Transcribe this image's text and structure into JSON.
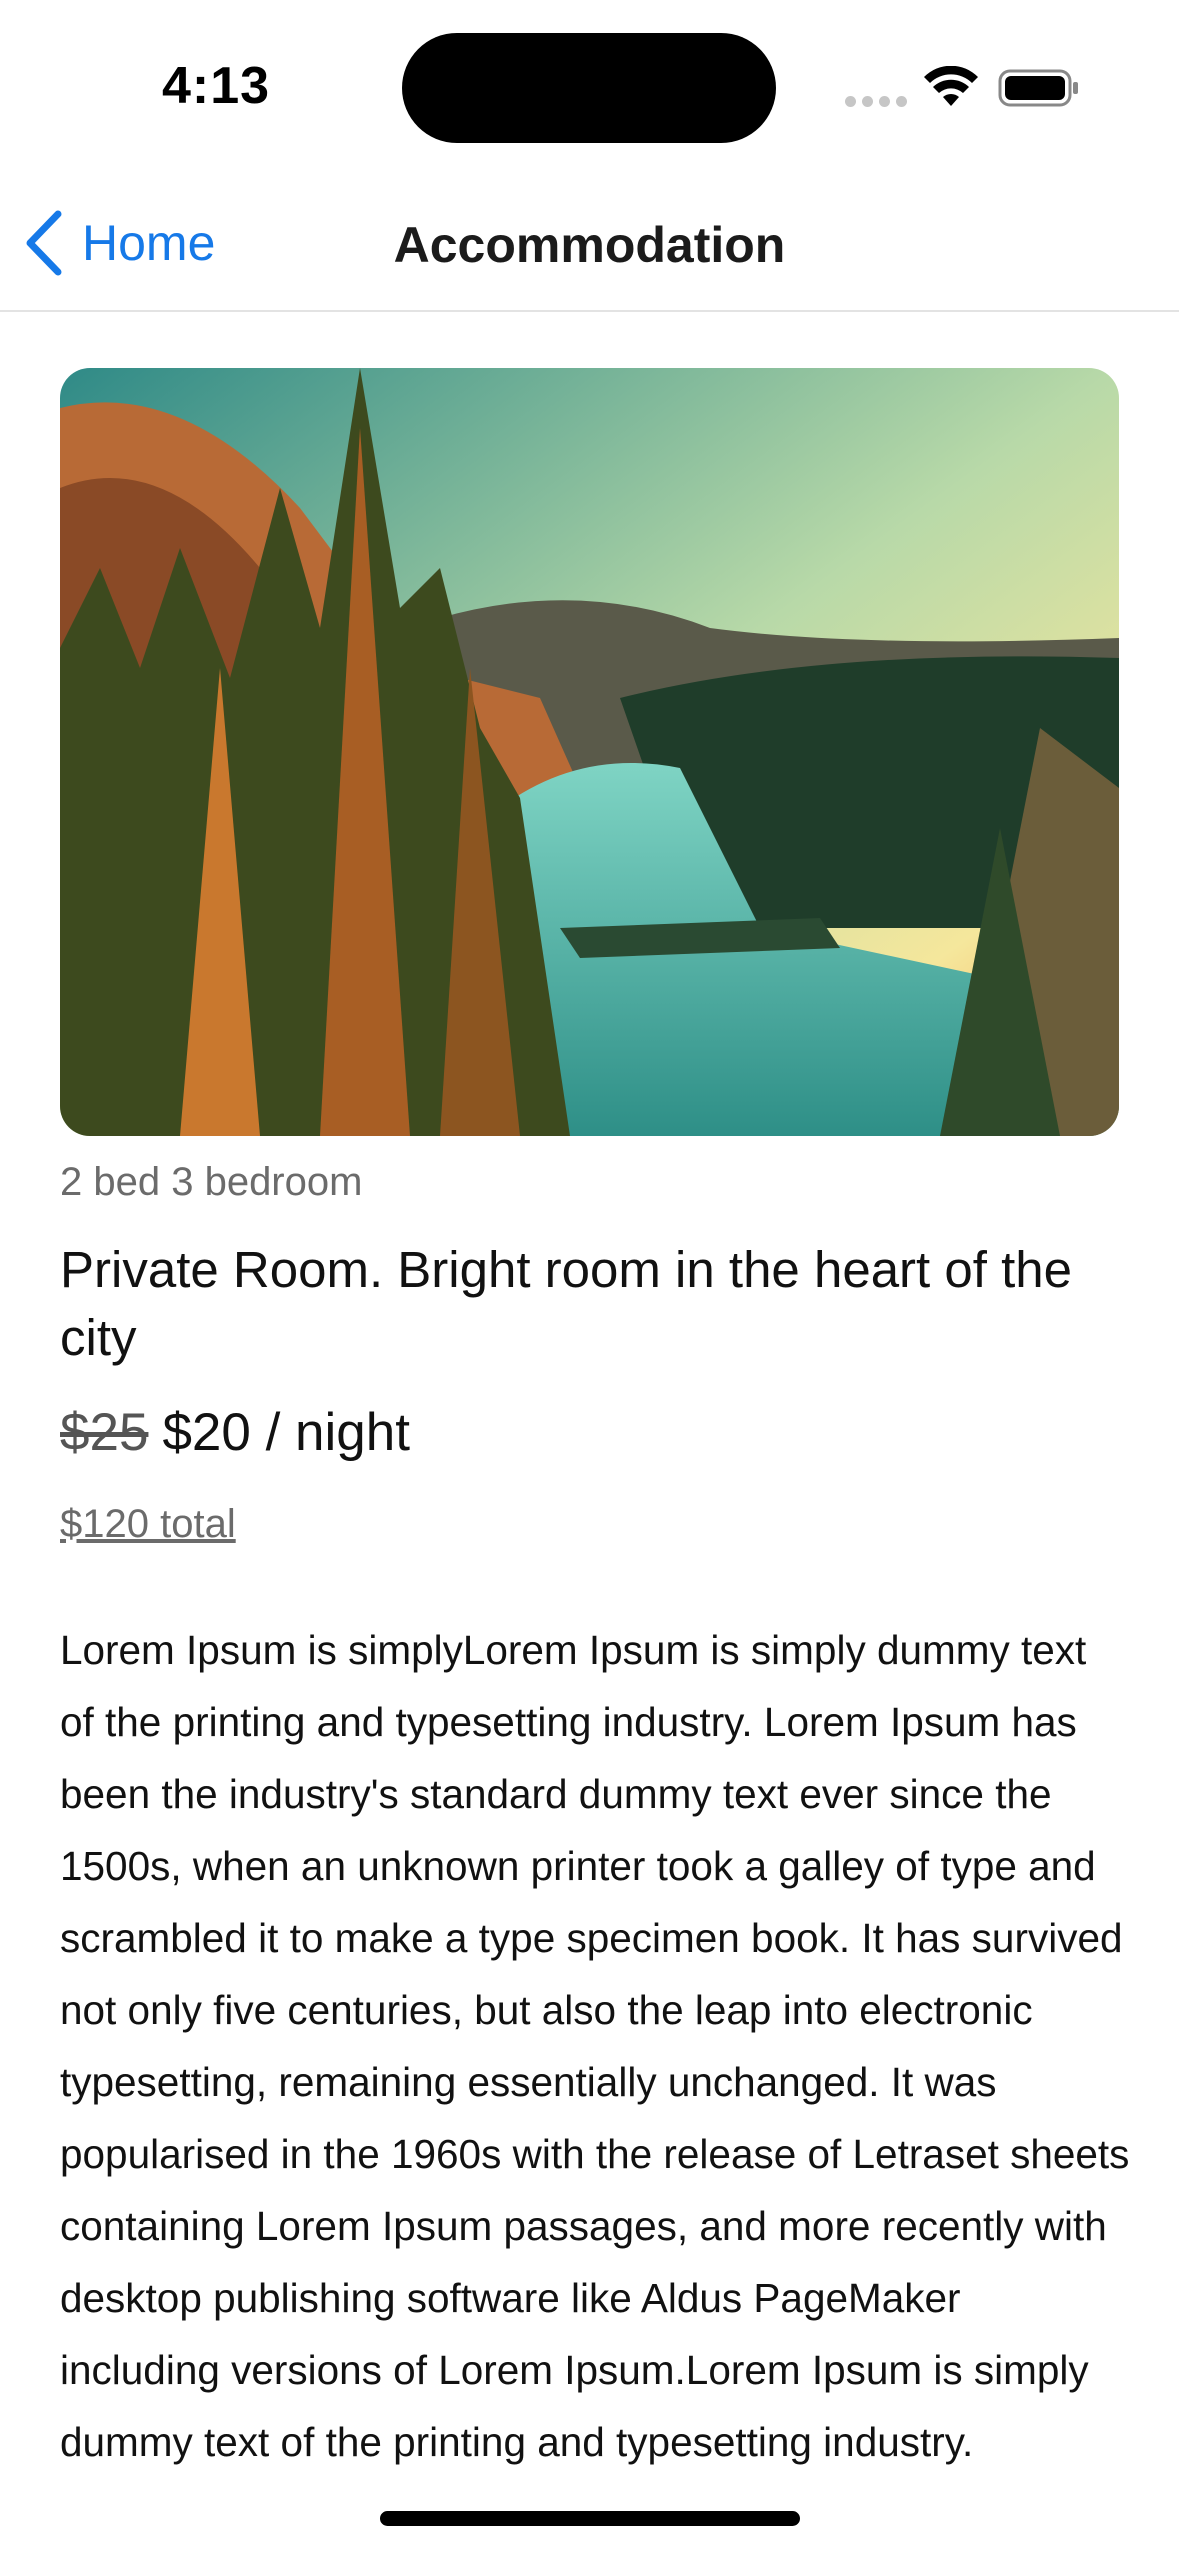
{
  "status_bar": {
    "time": "4:13",
    "icons": [
      "cellular-signal-icon",
      "wifi-icon",
      "battery-icon"
    ]
  },
  "nav": {
    "back_label": "Home",
    "title": "Accommodation",
    "back_icon": "chevron-left-icon",
    "accent_color": "#1679e8"
  },
  "listing": {
    "image_alt": "Mountain lake with pine trees at sunset",
    "beds": "2 bed 3 bedroom",
    "title": "Private Room. Bright room in the heart of the city",
    "old_price": "$25",
    "price": "$20 / night",
    "total": "$120 total",
    "description": "Lorem Ipsum is simplyLorem Ipsum is simply dummy text of the printing and typesetting industry. Lorem Ipsum has been the industry's standard dummy text ever since the 1500s, when an unknown printer took a galley of type and scrambled it to make a type specimen book. It has survived not only five centuries, but also the leap into electronic typesetting, remaining essentially unchanged. It was popularised in the 1960s with the release of Letraset sheets containing Lorem Ipsum passages, and more recently with desktop publishing software like Aldus PageMaker including versions of Lorem Ipsum.Lorem Ipsum is simply dummy text of the printing and typesetting industry."
  }
}
